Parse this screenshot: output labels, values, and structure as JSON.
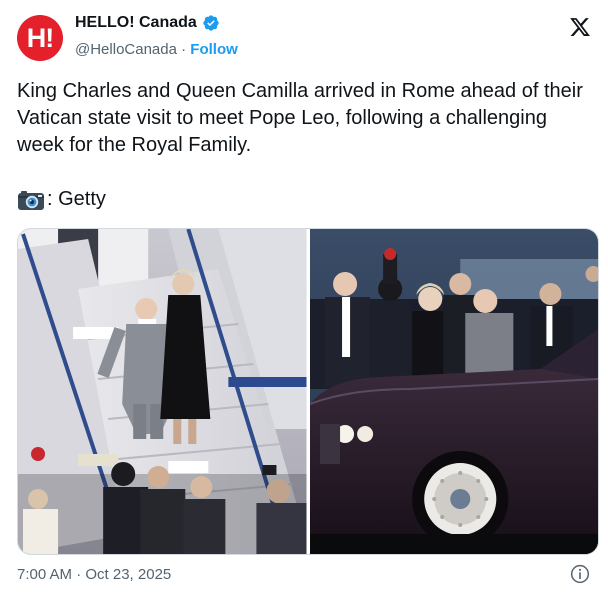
{
  "account": {
    "avatar_text": "H!",
    "display_name": "HELLO! Canada",
    "handle": "@HelloCanada",
    "separator": " · ",
    "follow_label": "Follow",
    "verified": true,
    "verified_color": "#1d9bf0"
  },
  "platform_icon": "x-logo-icon",
  "tweet": {
    "text": "King Charles and Queen Camilla arrived in Rome ahead of their Vatican state visit to meet Pope Leo, following a challenging week for the Royal Family.",
    "credit_icon": "camera-emoji-icon",
    "credit_text": ": Getty"
  },
  "media": {
    "count": 2,
    "left_photo_icon": "photo-plane-stairs",
    "right_photo_icon": "photo-car-arrival"
  },
  "footer": {
    "timestamp": "7:00 AM · Oct 23, 2025",
    "info_icon": "info-icon"
  },
  "colors": {
    "brand": "#e4202a",
    "link": "#1d9bf0",
    "secondary_text": "#536471"
  }
}
